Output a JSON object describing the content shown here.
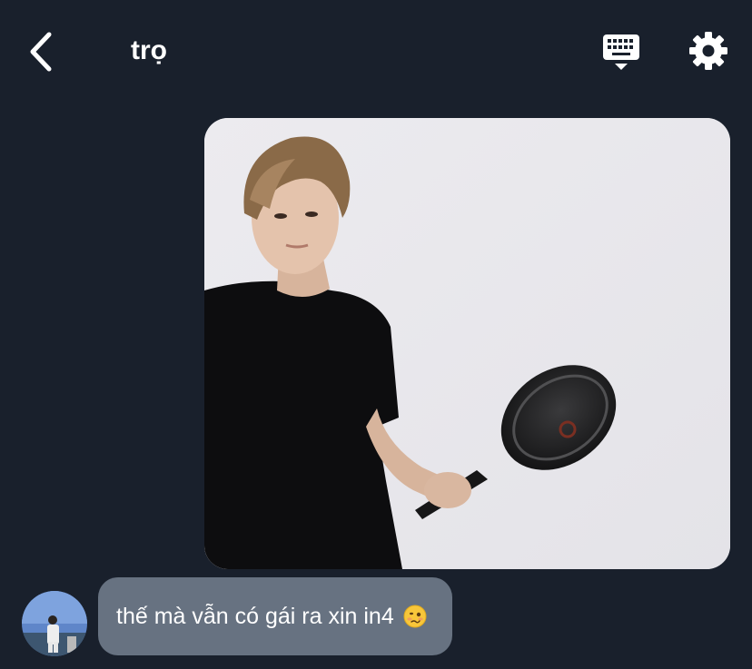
{
  "header": {
    "title": "trọ",
    "back_icon": "chevron-left-icon",
    "keyboard_icon": "keyboard-icon",
    "settings_icon": "gear-icon"
  },
  "messages": [
    {
      "type": "image",
      "direction": "outgoing",
      "image_description": "person-holding-frying-pan"
    },
    {
      "type": "text",
      "direction": "incoming",
      "text": "thế mà vẫn có gái ra xin in4",
      "emoji_icon": "woozy-face-emoji-icon"
    }
  ],
  "colors": {
    "background": "#19202c",
    "bubble": "#677281",
    "text": "#ffffff"
  }
}
